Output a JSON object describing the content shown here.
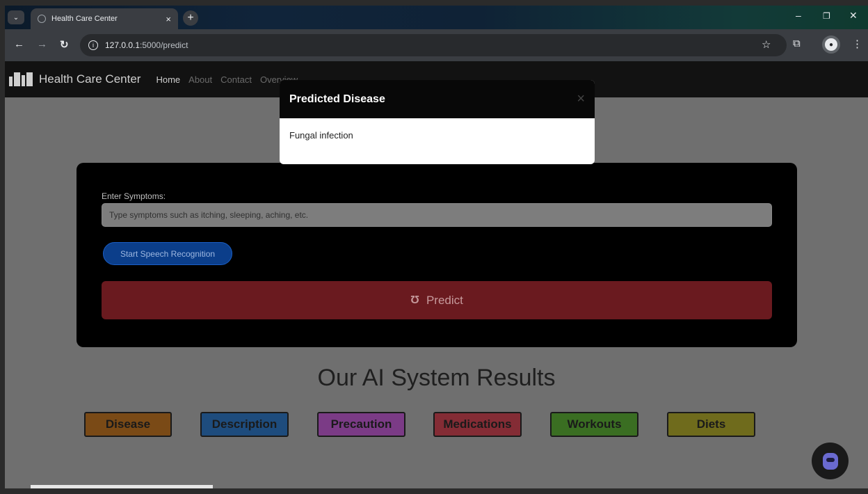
{
  "browser": {
    "tab_title": "Health Care Center",
    "tab_close": "×",
    "new_tab": "+",
    "url_host": "127.0.0.1",
    "url_path": ":5000/predict",
    "window_controls": [
      "–",
      "❐",
      "✕"
    ]
  },
  "navbar": {
    "brand": "Health Care Center",
    "links": [
      "Home",
      "About",
      "Contact",
      "Overview"
    ]
  },
  "form": {
    "symptoms_label": "Enter Symptoms:",
    "symptoms_placeholder": "Type symptoms such as itching, sleeping, aching, etc.",
    "speech_button": "Start Speech Recognition",
    "predict_button": "Predict"
  },
  "results": {
    "title": "Our AI System Results",
    "buttons": [
      {
        "label": "Disease",
        "color": "#7a4a16"
      },
      {
        "label": "Description",
        "color": "#1e4c7d"
      },
      {
        "label": "Precaution",
        "color": "#7b3b86"
      },
      {
        "label": "Medications",
        "color": "#842c35"
      },
      {
        "label": "Workouts",
        "color": "#3a6e22"
      },
      {
        "label": "Diets",
        "color": "#6f6b1c"
      }
    ]
  },
  "modal": {
    "title": "Predicted Disease",
    "body": "Fungal infection",
    "close": "×"
  },
  "colors": {
    "overlay": "#6f6f6f",
    "predict": "#6a1a1f",
    "speech": "#0b3e8a"
  }
}
